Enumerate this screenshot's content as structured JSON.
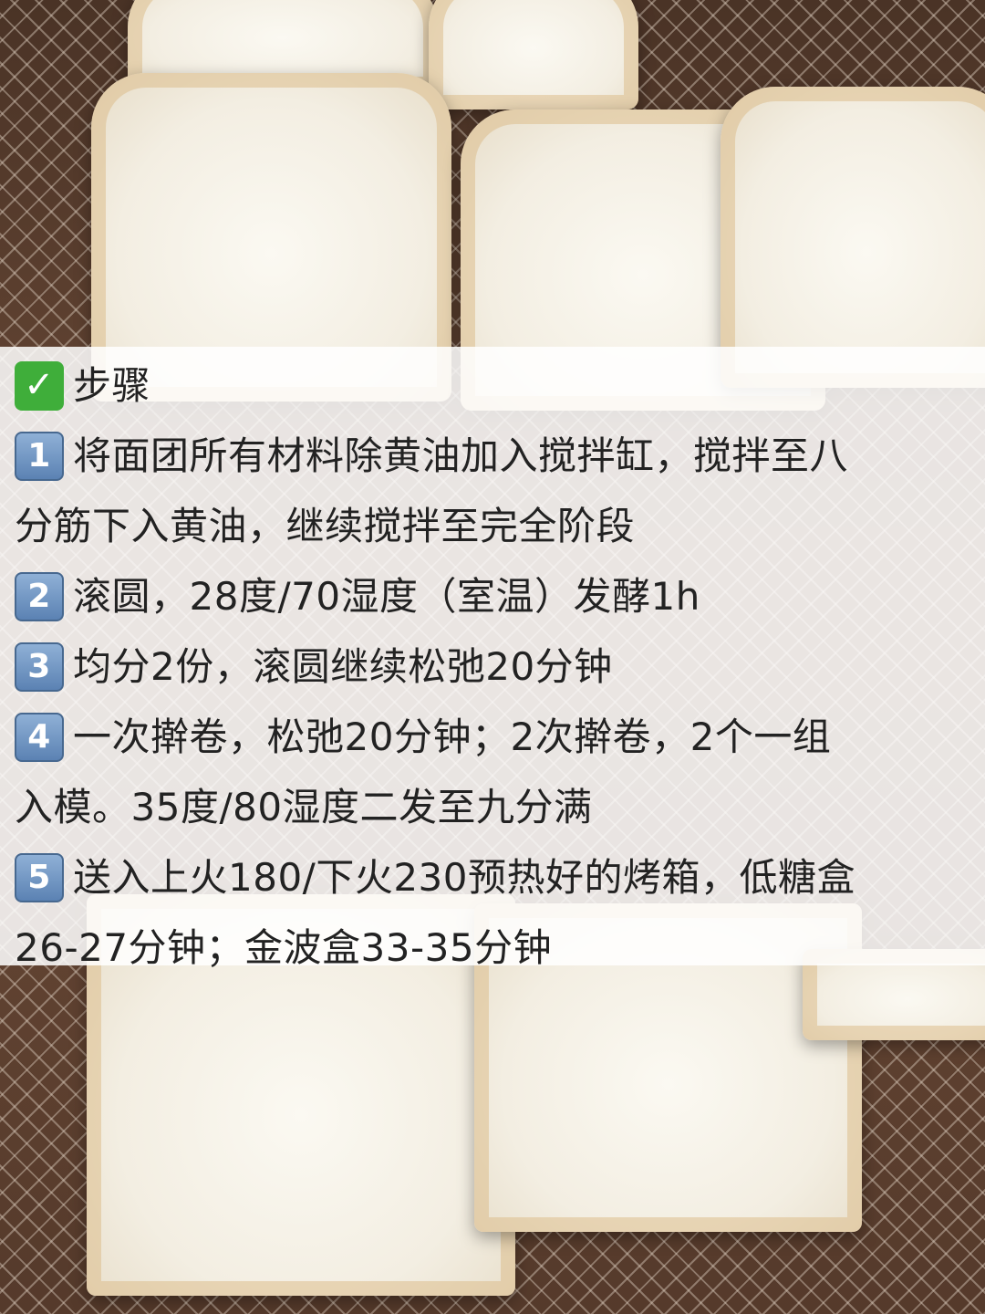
{
  "image": {
    "subject": "sliced milk bread loaves on wire cooling rack",
    "colors": {
      "crust": "#dcae6e",
      "crumb": "#f6f2e8",
      "rack": "#d7c8b9",
      "background": "#5b3f2e",
      "check_icon": "#3fae3a",
      "number_icon": "#5b82b3"
    }
  },
  "steps_panel": {
    "heading_icon": "check-mark-button-icon",
    "heading": "步骤",
    "steps": [
      {
        "badge": "1",
        "line1": "将面团所有材料除黄油加入搅拌缸，搅拌至八",
        "line2": "分筋下入黄油，继续搅拌至完全阶段"
      },
      {
        "badge": "2",
        "line1": "滚圆，28度/70湿度（室温）发酵1h"
      },
      {
        "badge": "3",
        "line1": "均分2份，滚圆继续松弛20分钟"
      },
      {
        "badge": "4",
        "line1": "一次擀卷，松弛20分钟；2次擀卷，2个一组",
        "line2": "入模。35度/80湿度二发至九分满"
      },
      {
        "badge": "5",
        "line1": "送入上火180/下火230预热好的烤箱，低糖盒",
        "line2": "26-27分钟；金波盒33-35分钟"
      }
    ]
  }
}
